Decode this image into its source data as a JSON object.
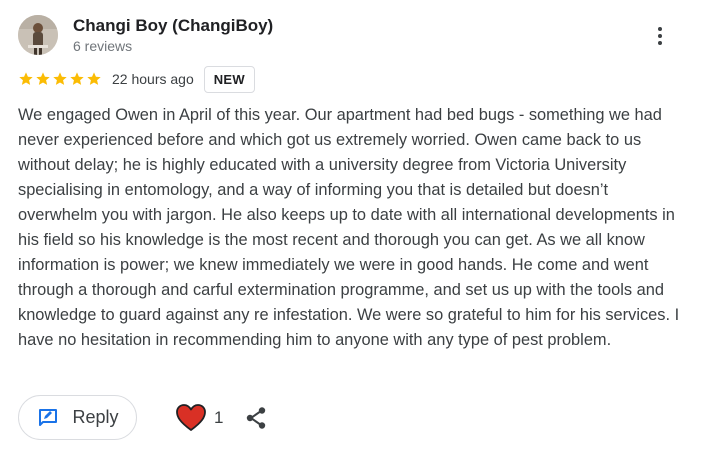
{
  "author": {
    "name": "Changi Boy (ChangiBoy)",
    "review_count": "6 reviews",
    "avatar_icon": "profile-photo"
  },
  "review": {
    "rating": 5,
    "max_rating": 5,
    "timestamp": "22 hours ago",
    "badge": "NEW",
    "text": "We engaged Owen in April of this year. Our apartment had bed bugs - something we had never experienced before and which got us extremely worried. Owen came back to us without delay; he is highly educated with a university degree from Victoria University specialising in entomology, and a way of informing you that is detailed but doesn’t overwhelm you with jargon. He also keeps up to date with all international developments in his field so his knowledge is the most recent and thorough you can get. As we all know information is power; we knew immediately we were in good hands. He come and went through a thorough and carful extermination programme, and set us up with the tools and knowledge to guard against any re infestation. We were so grateful to him for his services. I have no hesitation in recommending him to anyone with any type of pest problem."
  },
  "actions": {
    "reply_label": "Reply",
    "like_count": "1",
    "more_icon": "more-vert-icon",
    "reply_icon": "edit-icon",
    "like_icon": "heart-icon",
    "share_icon": "share-icon"
  },
  "colors": {
    "star": "#fbbc04",
    "heart": "#d93025",
    "reply_icon": "#1a73e8"
  }
}
